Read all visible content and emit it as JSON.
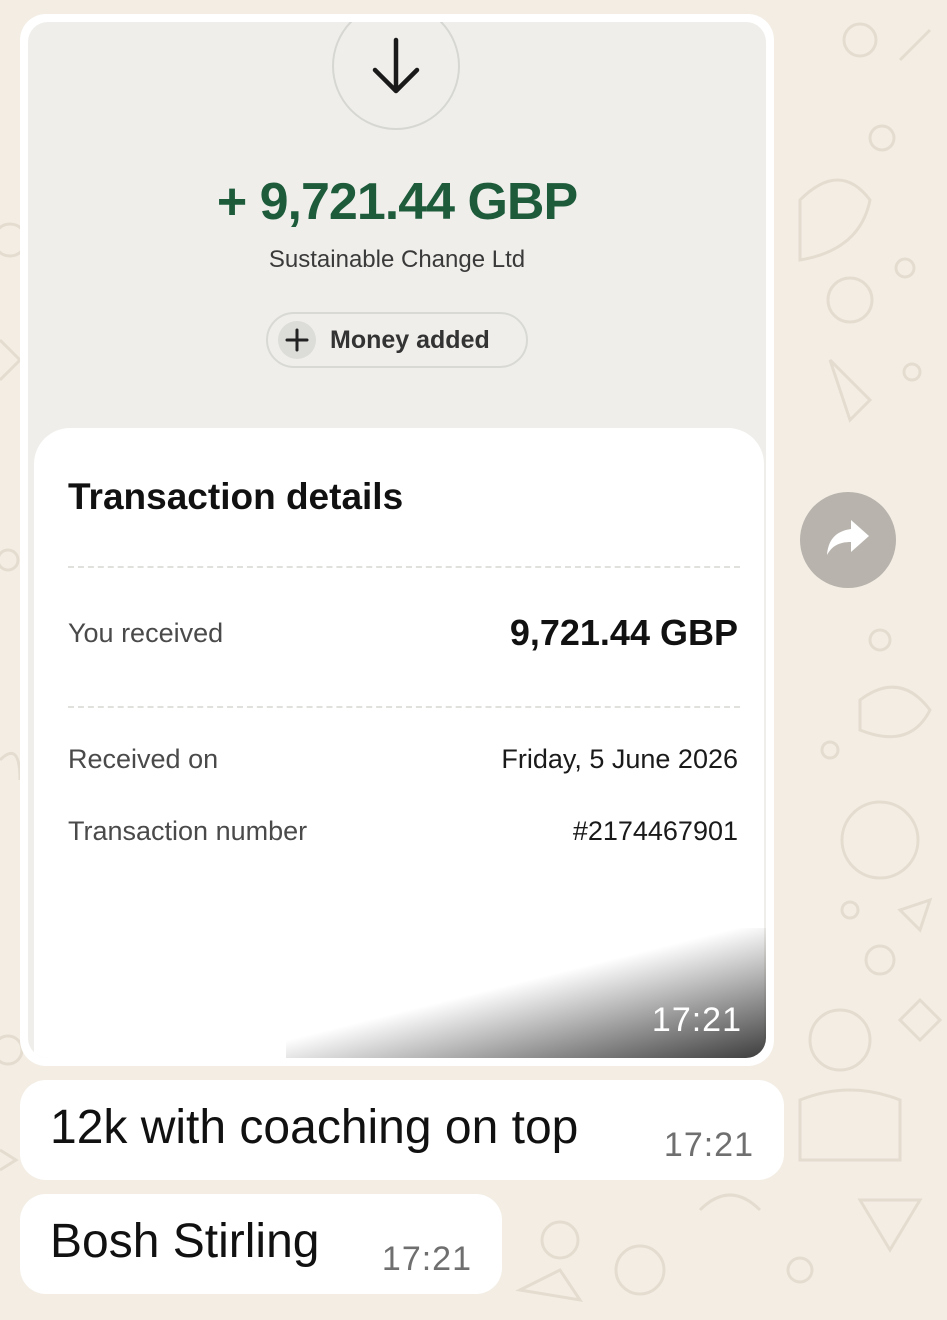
{
  "screenshot": {
    "amount": "+ 9,721.44 GBP",
    "payer": "Sustainable Change Ltd",
    "status_label": "Money added",
    "details": {
      "title": "Transaction details",
      "you_received_label": "You received",
      "you_received_value": "9,721.44 GBP",
      "received_on_label": "Received on",
      "received_on_value": "Friday, 5 June 2026",
      "transaction_number_label": "Transaction number",
      "transaction_number_value": "#2174467901"
    }
  },
  "image_message": {
    "time": "17:21"
  },
  "messages": [
    {
      "text": "12k with coaching on top",
      "time": "17:21"
    },
    {
      "text": "Bosh Stirling",
      "time": "17:21"
    }
  ],
  "colors": {
    "amount_green": "#1d5b3b",
    "chat_background": "#f3ede4",
    "bubble": "#ffffff"
  },
  "icons": [
    "down-arrow-icon",
    "plus-icon",
    "forward-icon"
  ]
}
